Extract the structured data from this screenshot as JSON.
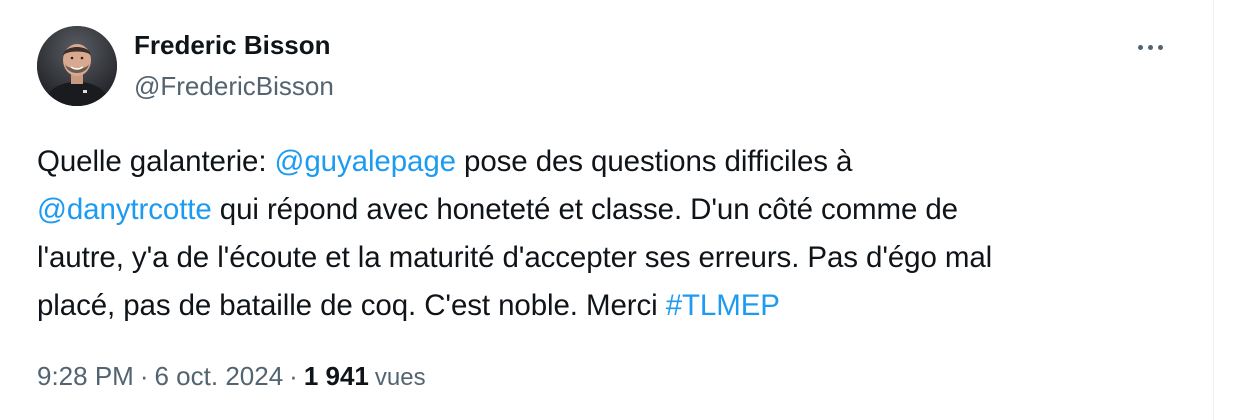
{
  "author": {
    "display_name": "Frederic Bisson",
    "handle": "@FredericBisson"
  },
  "more_icon": "more-horizontal-icon",
  "tweet": {
    "line1": {
      "t1": "Quelle galanterie: ",
      "mention1": "@guyalepage",
      "t2": " pose des questions difficiles à"
    },
    "line2": {
      "mention2": "@danytrcotte",
      "t3": " qui répond avec honeteté et classe. D'un côté comme de"
    },
    "line3": "l'autre, y'a de l'écoute et la maturité d'accepter ses erreurs. Pas d'égo mal",
    "line4": {
      "t4": "placé, pas de bataille de coq. C'est noble. Merci ",
      "hashtag": "#TLMEP"
    }
  },
  "meta": {
    "time": "9:28 PM",
    "separator1": "·",
    "date": "6 oct. 2024",
    "separator2": "·",
    "views_count": "1 941",
    "views_label": "vues"
  },
  "colors": {
    "link": "#1d9bf0",
    "text": "#0f1419",
    "secondary": "#536471"
  }
}
